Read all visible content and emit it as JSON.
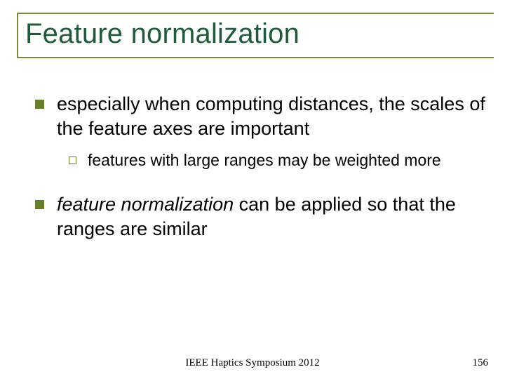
{
  "title": "Feature normalization",
  "bullets": {
    "p1": "especially when computing distances, the scales of the feature axes are important",
    "p1_sub1": "features with large ranges may be weighted more",
    "p2_italic": "feature normalization",
    "p2_rest": " can be applied so that the ranges are similar"
  },
  "footer": "IEEE Haptics Symposium 2012",
  "page": "156"
}
